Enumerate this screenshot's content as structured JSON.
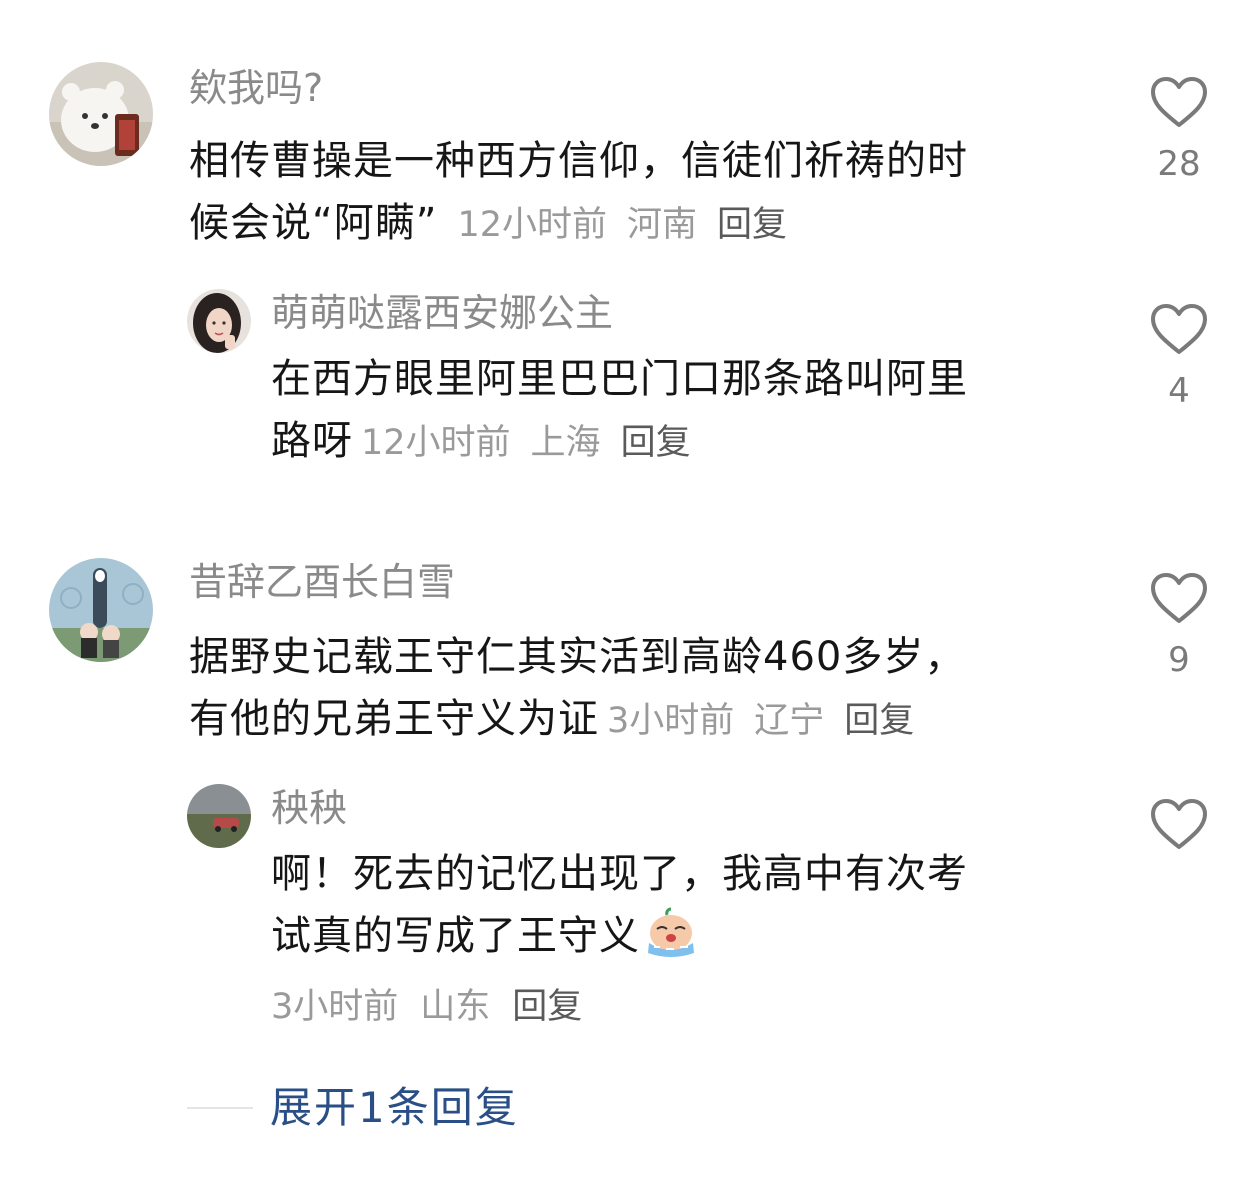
{
  "comments": [
    {
      "user": "欸我吗?",
      "text": "相传曹操是一种西方信仰，信徒们祈祷的时候会说“阿瞒”",
      "text_lines": [
        "相传曹操是一种西方信仰，信徒们祈祷的时",
        "候会说“阿瞒”"
      ],
      "time": "12小时前",
      "location": "河南",
      "reply_label": "回复",
      "likes": "28",
      "avatar_icon": "white-bear-avatar-icon",
      "replies": [
        {
          "user": "萌萌哒露西安娜公主",
          "text": "在西方眼里阿里巴巴门口那条路叫阿里路呀",
          "text_lines": [
            "在西方眼里阿里巴巴门口那条路叫阿里",
            "路呀"
          ],
          "time": "12小时前",
          "location": "上海",
          "reply_label": "回复",
          "likes": "4",
          "avatar_icon": "woman-portrait-avatar-icon"
        }
      ]
    },
    {
      "user": "昔辞乙酉长白雪",
      "text": "据野史记载王守仁其实活到高龄460多岁，有他的兄弟王守义为证",
      "text_lines": [
        "据野史记载王守仁其实活到高龄460多岁，",
        "有他的兄弟王守义为证"
      ],
      "time": "3小时前",
      "location": "辽宁",
      "reply_label": "回复",
      "likes": "9",
      "avatar_icon": "cartoon-characters-avatar-icon",
      "replies": [
        {
          "user": "秧秧",
          "text": "啊！死去的记忆出现了，我高中有次考试真的写成了王守义",
          "text_lines": [
            "啊！死去的记忆出现了，我高中有次考",
            "试真的写成了王守义"
          ],
          "emoji": "crying-emoji-icon",
          "time": "3小时前",
          "location": "山东",
          "reply_label": "回复",
          "likes": "",
          "avatar_icon": "landscape-car-avatar-icon"
        }
      ]
    }
  ],
  "expand_replies_label": "展开1条回复",
  "colors": {
    "username": "#8a8a8a",
    "text": "#161616",
    "meta": "#9a9a9a",
    "reply": "#5a5a5a",
    "expand": "#2a4f86",
    "heart": "#7a7a7a"
  }
}
